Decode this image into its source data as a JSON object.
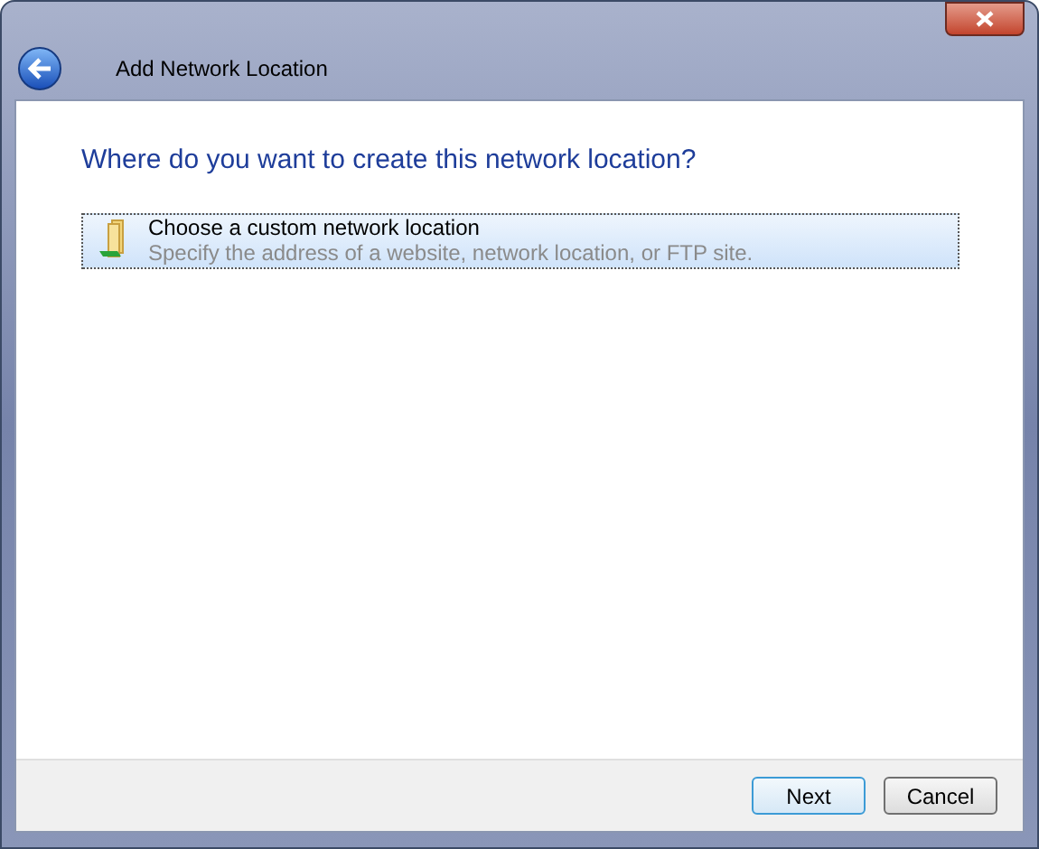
{
  "window": {
    "title": "Add Network Location"
  },
  "heading": "Where do you want to create this network location?",
  "options": [
    {
      "title": "Choose a custom network location",
      "description": "Specify the address of a website, network location, or FTP site.",
      "selected": true
    }
  ],
  "buttons": [
    {
      "label": "Next",
      "default": true
    },
    {
      "label": "Cancel",
      "default": false
    }
  ]
}
